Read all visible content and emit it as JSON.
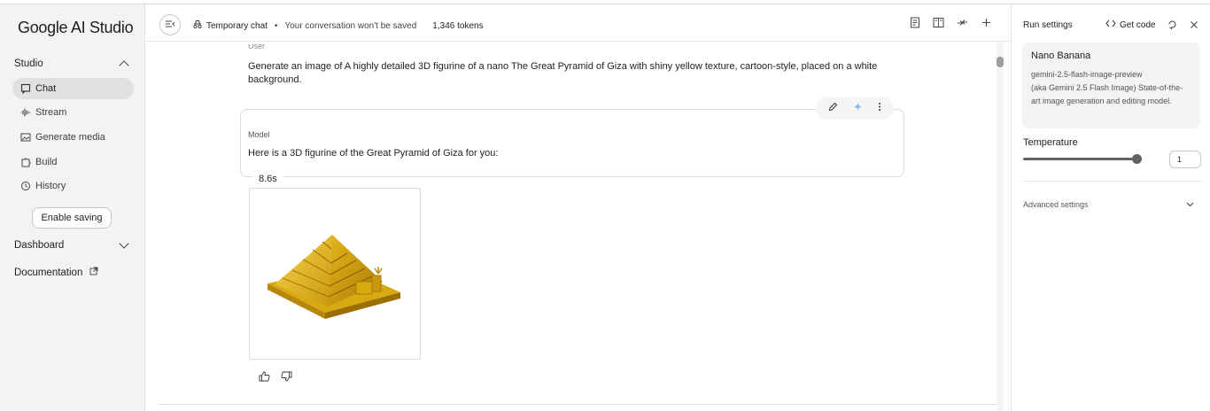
{
  "app": {
    "logo": "Google AI Studio"
  },
  "sidebar": {
    "studio_label": "Studio",
    "items": [
      {
        "label": "Chat",
        "icon": "chat-icon",
        "active": true
      },
      {
        "label": "Stream",
        "icon": "waveform-icon"
      },
      {
        "label": "Generate media",
        "icon": "image-icon"
      },
      {
        "label": "Build",
        "icon": "puzzle-icon"
      },
      {
        "label": "History",
        "icon": "history-icon"
      }
    ],
    "enable_saving": "Enable saving",
    "dashboard_label": "Dashboard",
    "documentation_label": "Documentation"
  },
  "topbar": {
    "chat_title": "Temporary chat",
    "dot": "•",
    "subtitle": "Your conversation won't be saved",
    "tokens": "1,346 tokens"
  },
  "conversation": {
    "user_label": "User",
    "user_text": "Generate an image of A highly detailed 3D figurine of a nano The Great Pyramid of Giza with shiny yellow texture, cartoon-style, placed on a white background.",
    "model_label": "Model",
    "model_text": "Here is a 3D figurine of the Great Pyramid of Giza for you:",
    "time": "8.6s"
  },
  "run_settings": {
    "title": "Run settings",
    "get_code": "Get code",
    "model_name": "Nano Banana",
    "model_id": "gemini-2.5-flash-image-preview",
    "model_desc": "(aka Gemini 2.5 Flash Image) State-of-the-art image generation and editing model.",
    "temperature_label": "Temperature",
    "temperature_value": "1",
    "temperature_level": 1.0,
    "advanced_label": "Advanced settings"
  },
  "colors": {
    "gold": "#e0b21a",
    "gold_dark": "#b8860b",
    "sidebar_bg": "#f3f3f3"
  }
}
